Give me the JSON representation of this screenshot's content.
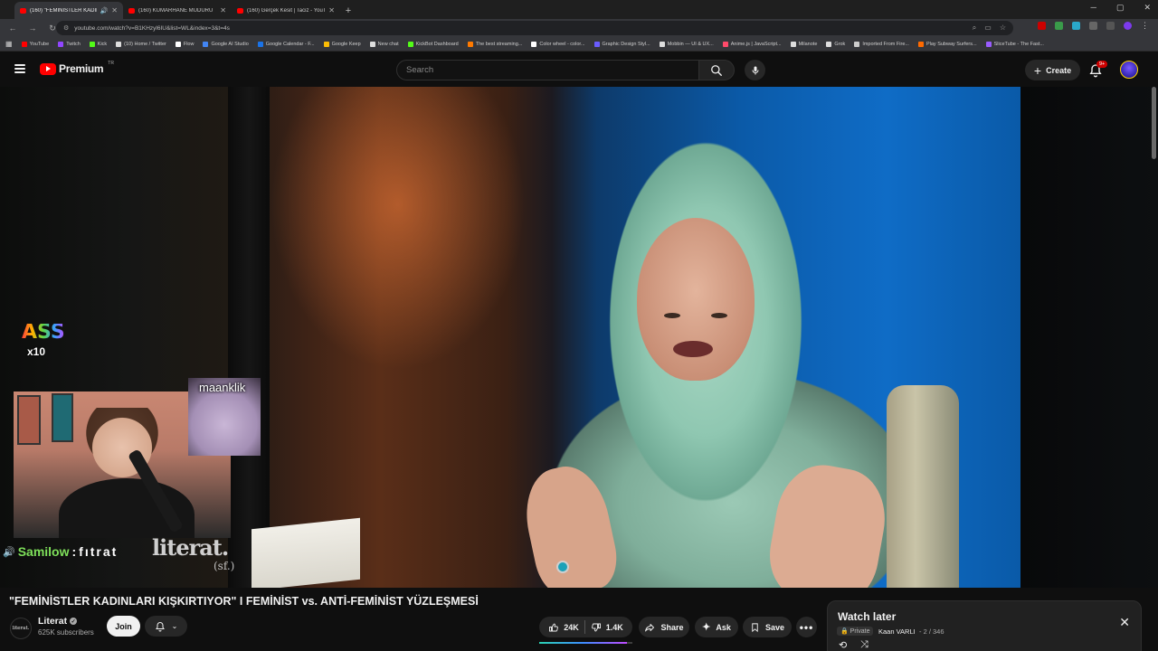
{
  "browser": {
    "tabs": [
      {
        "title": "(160) \"FEMİNİSTLER KADIN",
        "active": true,
        "audio": true
      },
      {
        "title": "(160) KUMARHANE MÜDÜRÜ",
        "active": false
      },
      {
        "title": "(160) Gerçek Kesit | Taciz - YouT",
        "active": false
      }
    ],
    "new_tab": "+",
    "url": "youtube.com/watch?v=B1KHzyl6IU&list=WL&index=3&t=4s",
    "bookmarks": [
      {
        "label": "YouTube",
        "color": "#ff0000"
      },
      {
        "label": "Twitch",
        "color": "#9146ff"
      },
      {
        "label": "Kick",
        "color": "#53fc18"
      },
      {
        "label": "(10) Home / Twitter",
        "color": "#dddddd"
      },
      {
        "label": "Flow",
        "color": "#ffffff"
      },
      {
        "label": "Google AI Studio",
        "color": "#4285f4"
      },
      {
        "label": "Google Calendar - F...",
        "color": "#1a73e8"
      },
      {
        "label": "Google Keep",
        "color": "#fbbc04"
      },
      {
        "label": "New chat",
        "color": "#dddddd"
      },
      {
        "label": "KickBot Dashboard",
        "color": "#53fc18"
      },
      {
        "label": "The best streaming...",
        "color": "#ff7a00"
      },
      {
        "label": "Color wheel - color...",
        "color": "#ffffff"
      },
      {
        "label": "Graphic Design Styl...",
        "color": "#6a5cff"
      },
      {
        "label": "Mobbin — UI & UX...",
        "color": "#dddddd"
      },
      {
        "label": "Anime.js | JavaScript...",
        "color": "#ff4a6a"
      },
      {
        "label": "Milanote",
        "color": "#dddddd"
      },
      {
        "label": "Grok",
        "color": "#dddddd"
      },
      {
        "label": "Imported From Fire...",
        "color": "#cccccc"
      },
      {
        "label": "Play Subway Surfers...",
        "color": "#ff6a00"
      },
      {
        "label": "SliceTube - The Fast...",
        "color": "#9a5cff"
      }
    ]
  },
  "youtube": {
    "logo_text": "Premium",
    "logo_region": "TR",
    "search_placeholder": "Search",
    "create_label": "Create",
    "notifications_badge": "9+"
  },
  "overlay": {
    "badge_text": "ASS",
    "badge_multiplier": "x10",
    "guest_name": "maanklik",
    "chat_user": "Samilow",
    "chat_message": "fıtrat",
    "watermark": "literat.",
    "watermark_sub": "(sf.)"
  },
  "video": {
    "title": "\"FEMİNİSTLER KADINLARI KIŞKIRTIYOR\" I FEMİNİST vs. ANTİ-FEMİNİST YÜZLEŞMESİ",
    "channel_name": "Literat",
    "channel_avatar_text": "literat.",
    "subscribers": "625K subscribers",
    "join_label": "Join",
    "likes": "24K",
    "dislikes": "1.4K",
    "like_ratio": 0.94,
    "share_label": "Share",
    "ask_label": "Ask",
    "save_label": "Save"
  },
  "watch_later": {
    "title": "Watch later",
    "privacy": "Private",
    "owner": "Kaan VARLI",
    "position": "- 2 / 346"
  }
}
